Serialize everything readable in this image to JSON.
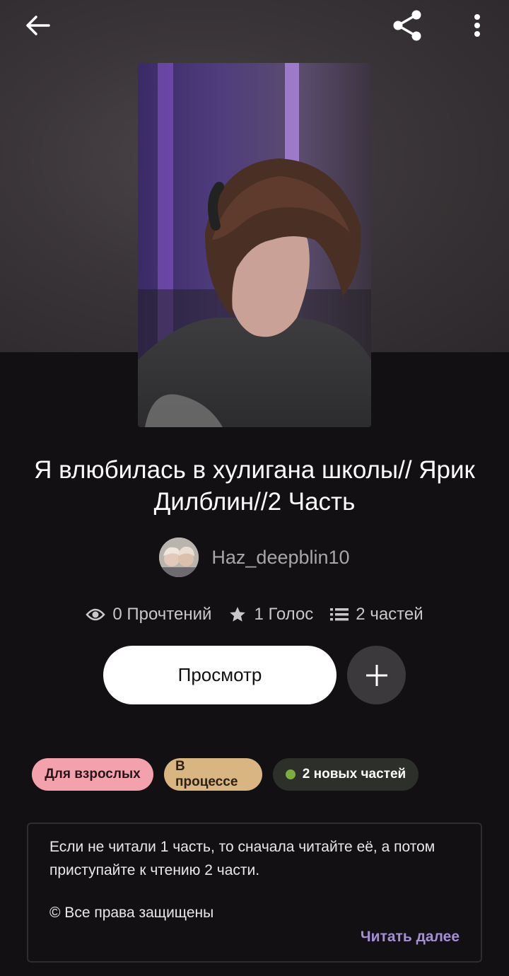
{
  "header": {
    "back_icon": "arrow-left-icon",
    "share_icon": "share-icon",
    "more_icon": "more-vertical-icon"
  },
  "story": {
    "title": "Я влюбилась в хулигана школы// Ярик Дилблин//2 Часть",
    "author": "Haz_deepblin10",
    "stats": {
      "reads": "0 Прочтений",
      "votes": "1 Голос",
      "parts": "2 частей"
    }
  },
  "actions": {
    "preview_label": "Просмотр",
    "add_icon": "plus-icon"
  },
  "tags": {
    "mature": "Для взрослых",
    "in_progress": "В процессе",
    "new_parts": "2 новых частей"
  },
  "description": {
    "text": "Если не читали 1 часть, то сначала читайте её, а потом приступайте к чтению 2 части.",
    "copyright": "© Все права защищены",
    "read_more": "Читать далее"
  },
  "colors": {
    "background": "#121013",
    "mature_tag": "#f3a2ad",
    "progress_tag": "#d8b581",
    "new_dot": "#7cae3f",
    "link": "#a68fd6"
  }
}
